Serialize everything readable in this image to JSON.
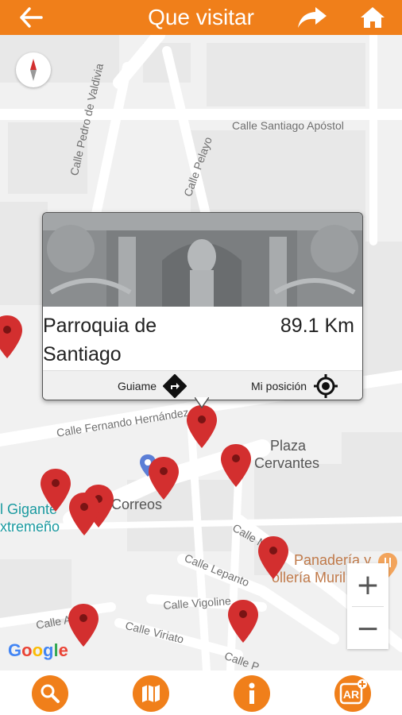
{
  "header": {
    "title": "Que visitar",
    "back_icon": "arrow-left-icon",
    "share_icon": "share-arrow-icon",
    "home_icon": "home-icon"
  },
  "map": {
    "streets": [
      "Calle Santiago Apóstol",
      "Calle Pedro de Valdivia",
      "Calle Pelayo",
      "Calle Fernando Hernández",
      "Calle Lepanto",
      "Calle Vigoline",
      "Calle Agua",
      "Calle Viriato",
      "Calle P",
      "Calle Ma"
    ],
    "places": {
      "plaza_line1": "Plaza",
      "plaza_line2": "Cervantes",
      "correos": "Correos",
      "gigante_line1": "l Gigante",
      "gigante_line2": "xtremeño",
      "panaderia_line1": "Panadería y",
      "panaderia_line2": "ollería Muril"
    },
    "google_logo": "Google",
    "zoom_in": "+",
    "zoom_out": "−",
    "compass_icon": "compass-icon"
  },
  "popup": {
    "name_line1": "Parroquia de",
    "name_line2": "Santiago",
    "distance": "89.1 Km",
    "guide_label": "Guiame",
    "position_label": "Mi posición"
  },
  "bottom_bar": {
    "search_icon": "search-icon",
    "map_icon": "map-icon",
    "info_icon": "info-icon",
    "ar_label": "AR"
  },
  "colors": {
    "accent": "#f07f1a",
    "pin": "#d32f2f"
  }
}
